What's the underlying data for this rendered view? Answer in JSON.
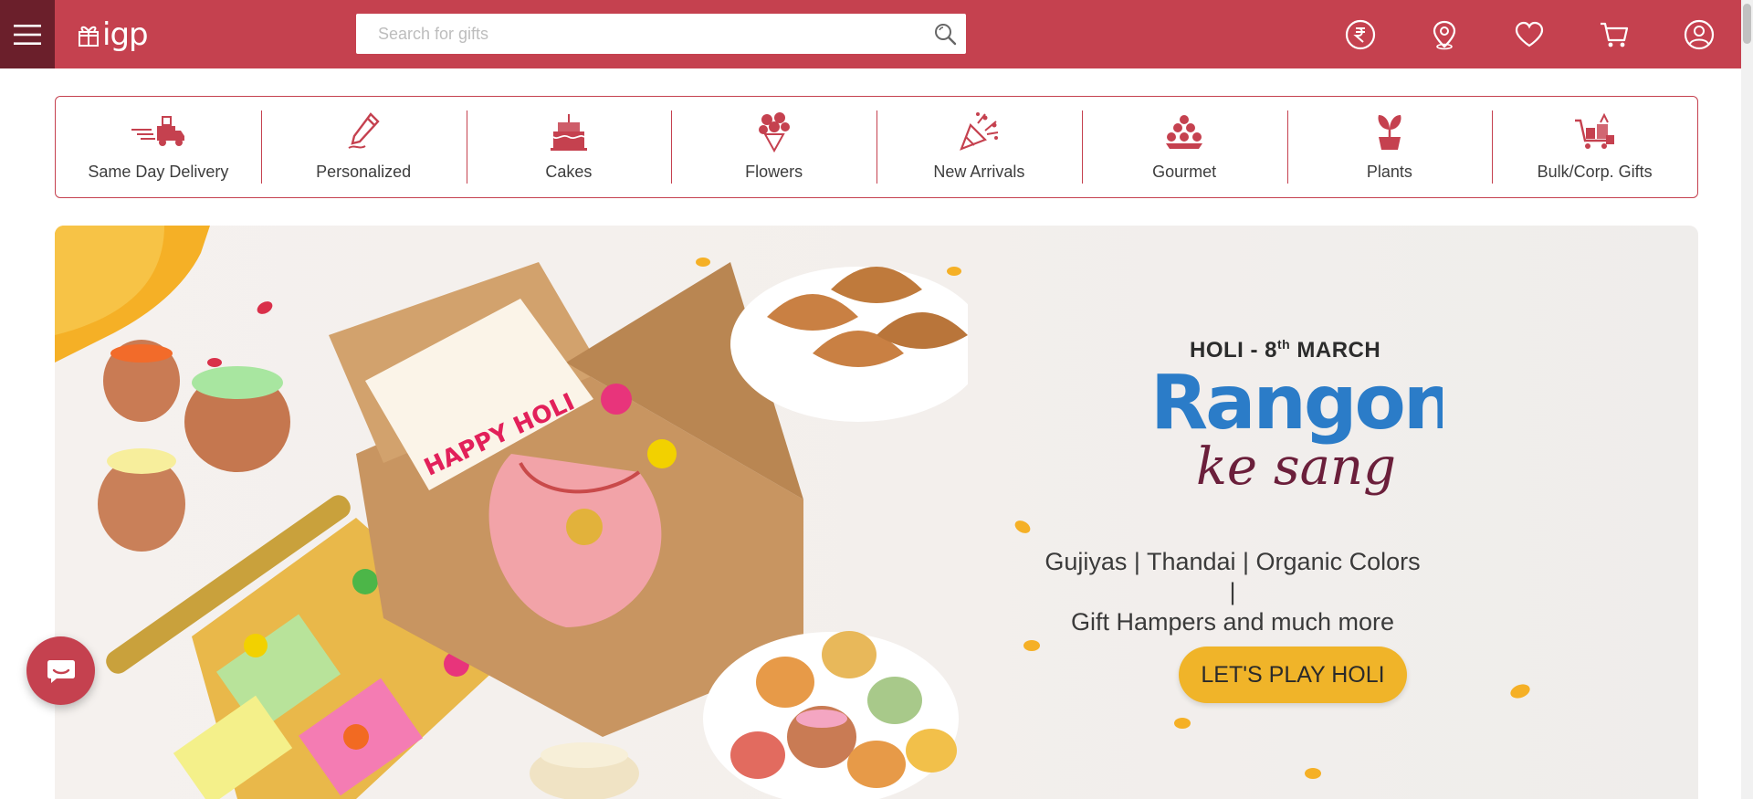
{
  "header": {
    "logo_text": "igp",
    "search_placeholder": "Search for gifts",
    "icons": [
      "rupee-currency-icon",
      "location-icon",
      "heart-icon",
      "cart-icon",
      "account-icon"
    ]
  },
  "categories": [
    {
      "label": "Same Day Delivery",
      "icon": "delivery-truck-icon"
    },
    {
      "label": "Personalized",
      "icon": "pencil-icon"
    },
    {
      "label": "Cakes",
      "icon": "cake-icon"
    },
    {
      "label": "Flowers",
      "icon": "bouquet-icon"
    },
    {
      "label": "New Arrivals",
      "icon": "party-popper-icon"
    },
    {
      "label": "Gourmet",
      "icon": "sweets-icon"
    },
    {
      "label": "Plants",
      "icon": "plant-icon"
    },
    {
      "label": "Bulk/Corp. Gifts",
      "icon": "gift-cart-icon"
    }
  ],
  "banner": {
    "date_prefix": "HOLI - 8",
    "date_sup": "th",
    "date_suffix": " MARCH",
    "headline": "Rangon",
    "headline_script": "ke sang",
    "tagline_line1": "Gujiyas | Thandai | Organic Colors |",
    "tagline_line2": "Gift Hampers and much more",
    "cta_label": "LET'S PLAY HOLI"
  },
  "colors": {
    "brand": "#c5414f",
    "brand_dark": "#6b1f2b",
    "cta": "#f0b429"
  }
}
